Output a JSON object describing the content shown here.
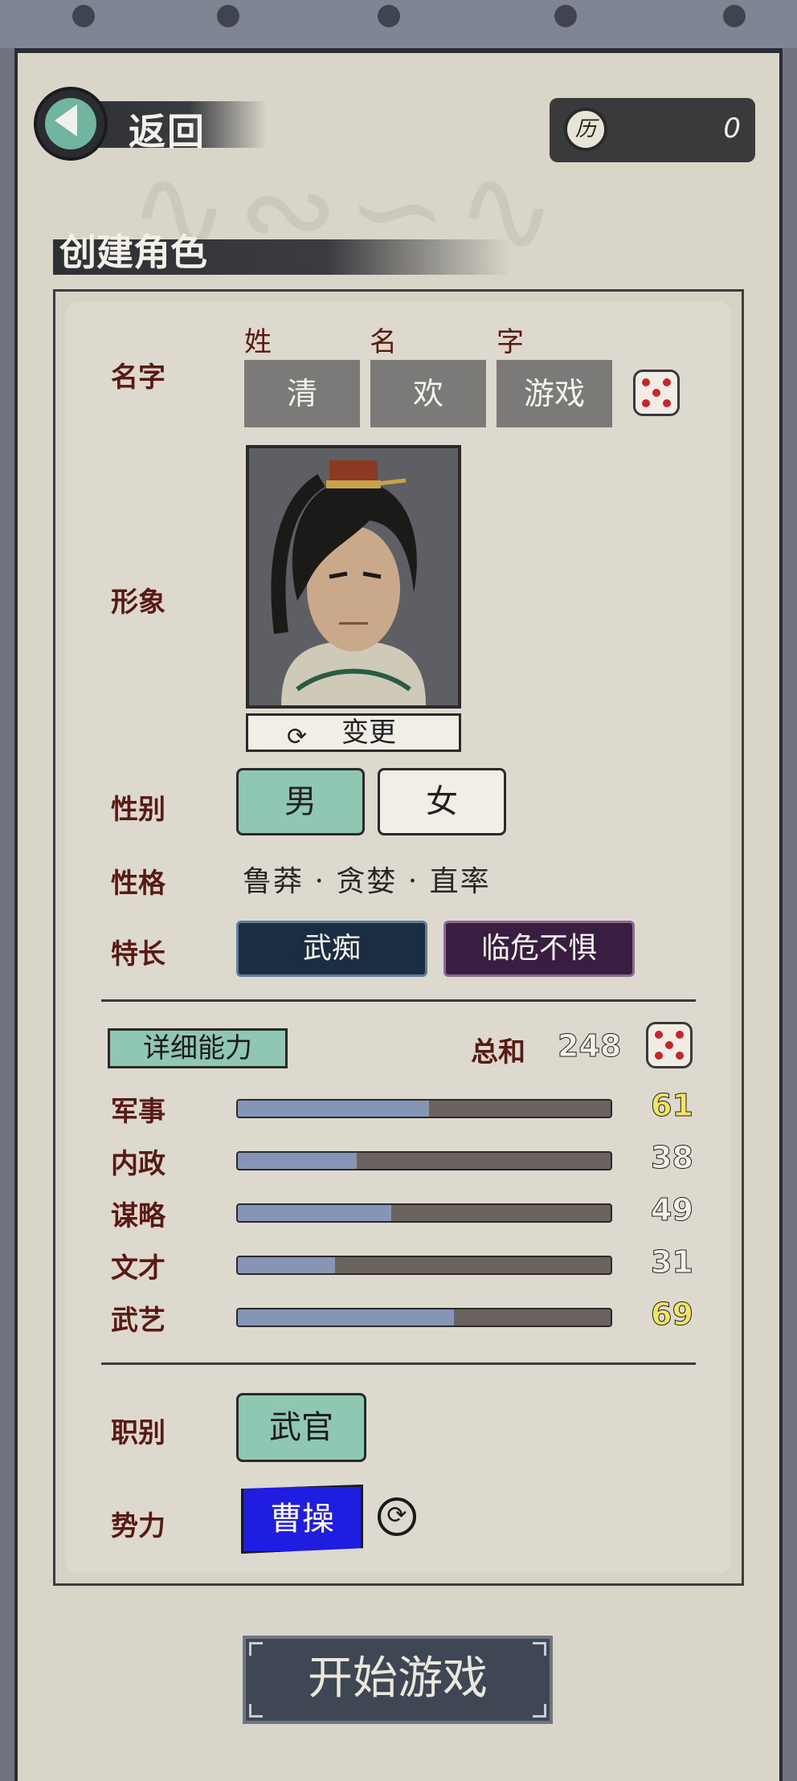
{
  "header": {
    "back_label": "返回",
    "currency_icon_char": "历",
    "currency_value": "0"
  },
  "section_title": "创建角色",
  "name_row": {
    "label": "名字",
    "col_labels": [
      "姓",
      "名",
      "字"
    ],
    "values": [
      "清",
      "欢",
      "游戏"
    ]
  },
  "portrait_row": {
    "label": "形象",
    "change_label": "变更"
  },
  "gender_row": {
    "label": "性别",
    "options": [
      "男",
      "女"
    ],
    "selected": "男"
  },
  "personality_row": {
    "label": "性格",
    "value": "鲁莽 · 贪婪 · 直率"
  },
  "specialty_row": {
    "label": "特长",
    "skills": [
      "武痴",
      "临危不惧"
    ]
  },
  "abilities": {
    "tag": "详细能力",
    "total_label": "总和",
    "total_value": "248",
    "max_value": 120,
    "stats": [
      {
        "label": "军事",
        "value": "61",
        "num": 61,
        "highlight": true
      },
      {
        "label": "内政",
        "value": "38",
        "num": 38,
        "highlight": false
      },
      {
        "label": "谋略",
        "value": "49",
        "num": 49,
        "highlight": false
      },
      {
        "label": "文才",
        "value": "31",
        "num": 31,
        "highlight": false
      },
      {
        "label": "武艺",
        "value": "69",
        "num": 69,
        "highlight": true
      }
    ]
  },
  "job_row": {
    "label": "职别",
    "value": "武官"
  },
  "faction_row": {
    "label": "势力",
    "value": "曹操"
  },
  "start_button": "开始游戏",
  "colors": {
    "accent_teal": "#8fc7b2",
    "skill_dark_blue": "#1a2d42",
    "skill_purple": "#3a1e42",
    "faction_blue": "#1f1de0",
    "highlight_yellow": "#f3e561",
    "label_red_brown": "#5a1a14"
  }
}
